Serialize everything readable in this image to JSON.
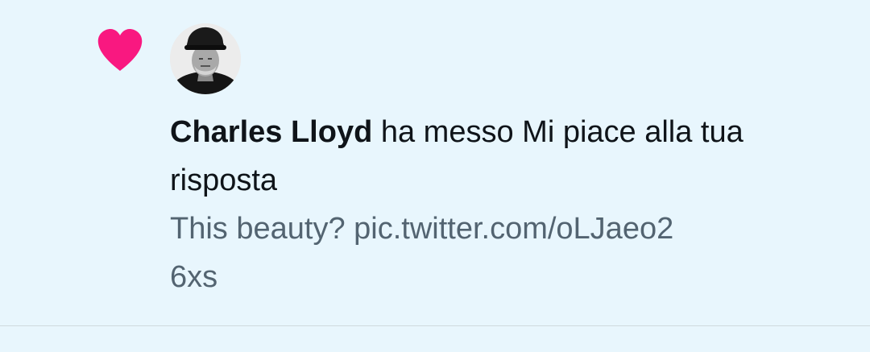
{
  "notification": {
    "icon": "heart-icon",
    "icon_color": "#f91880",
    "actor_name": "Charles Lloyd",
    "action_text": " ha messo Mi piace alla tua risposta",
    "tweet_text": "This beauty? pic.twitter.com/oLJaeo26xs"
  },
  "colors": {
    "background": "#e8f6fd",
    "primary_text": "#0f1419",
    "secondary_text": "#536471",
    "divider": "#cfd9de"
  }
}
